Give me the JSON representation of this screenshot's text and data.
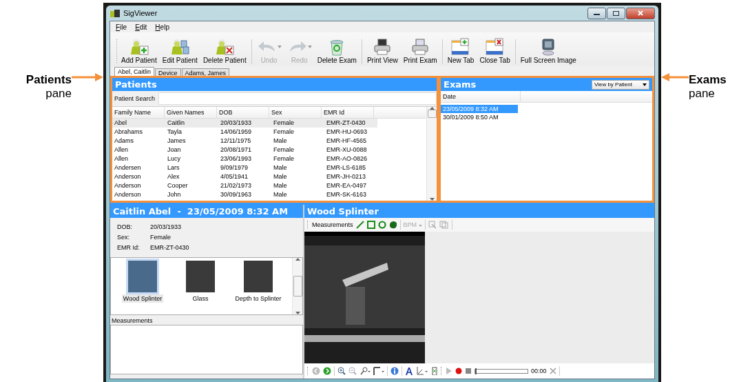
{
  "annotations": [
    {
      "title": "Patients",
      "subtitle": "pane"
    },
    {
      "title": "Exams",
      "subtitle": "pane"
    }
  ],
  "window": {
    "title": "SigViewer"
  },
  "menu": [
    "File",
    "Edit",
    "Help"
  ],
  "toolbar": [
    {
      "kind": "add-patient",
      "label": "Add Patient",
      "disabled": false
    },
    {
      "kind": "edit-patient",
      "label": "Edit Patient",
      "disabled": false
    },
    {
      "kind": "delete-patient",
      "label": "Delete Patient",
      "disabled": false
    },
    {
      "kind": "undo",
      "label": "Undo",
      "disabled": true
    },
    {
      "kind": "redo",
      "label": "Redo",
      "disabled": true
    },
    {
      "kind": "delete-exam",
      "label": "Delete Exam",
      "disabled": false
    },
    {
      "kind": "print-view",
      "label": "Print View",
      "disabled": false
    },
    {
      "kind": "print-exam",
      "label": "Print Exam",
      "disabled": false
    },
    {
      "kind": "new-tab",
      "label": "New Tab",
      "disabled": false
    },
    {
      "kind": "close-tab",
      "label": "Close Tab",
      "disabled": false
    },
    {
      "kind": "full-screen",
      "label": "Full Screen Image",
      "disabled": false
    }
  ],
  "tabs": [
    {
      "label": "Abel, Caitlin",
      "selected": true
    },
    {
      "label": "Device",
      "selected": false
    },
    {
      "label": "Adams, James",
      "selected": false
    }
  ],
  "patients": {
    "title": "Patients",
    "search_label": "Patient Search",
    "columns": [
      "Family Name",
      "Given Names",
      "DOB",
      "Sex",
      "EMR Id"
    ],
    "rows": [
      {
        "cells": [
          "Abel",
          "Caitlin",
          "20/03/1933",
          "Female",
          "EMR-ZT-0430"
        ],
        "selected": true
      },
      {
        "cells": [
          "Abrahams",
          "Tayla",
          "14/06/1959",
          "Female",
          "EMR-HU-0693"
        ],
        "selected": false
      },
      {
        "cells": [
          "Adams",
          "James",
          "12/11/1975",
          "Male",
          "EMR-HF-4565"
        ],
        "selected": false
      },
      {
        "cells": [
          "Allen",
          "Joan",
          "20/08/1971",
          "Female",
          "EMR-XU-0088"
        ],
        "selected": false
      },
      {
        "cells": [
          "Allen",
          "Lucy",
          "23/06/1993",
          "Female",
          "EMR-AO-0826"
        ],
        "selected": false
      },
      {
        "cells": [
          "Andersen",
          "Lars",
          "9/09/1979",
          "Male",
          "EMR-LS-6185"
        ],
        "selected": false
      },
      {
        "cells": [
          "Anderson",
          "Alex",
          "4/05/1941",
          "Male",
          "EMR-JH-0213"
        ],
        "selected": false
      },
      {
        "cells": [
          "Anderson",
          "Cooper",
          "21/02/1973",
          "Male",
          "EMR-EA-0497"
        ],
        "selected": false
      },
      {
        "cells": [
          "Anderson",
          "John",
          "30/09/1963",
          "Male",
          "EMR-SK-6163"
        ],
        "selected": false
      }
    ]
  },
  "exams": {
    "title": "Exams",
    "view_select": "View by Patient",
    "columns": [
      "Date"
    ],
    "rows": [
      {
        "date": "23/05/2009 8:32 AM",
        "selected": true
      },
      {
        "date": "30/01/2009 8:50 AM",
        "selected": false
      }
    ]
  },
  "detail": {
    "name": "Caitlin Abel",
    "date": "23/05/2009 8:32 AM",
    "separator": "-",
    "fields": [
      {
        "label": "DOB:",
        "value": "20/03/1933"
      },
      {
        "label": "Sex:",
        "value": "Female"
      },
      {
        "label": "EMR Id:",
        "value": "EMR-ZT-0430"
      }
    ],
    "images": [
      {
        "label": "Wood Splinter",
        "selected": true
      },
      {
        "label": "Glass",
        "selected": false
      },
      {
        "label": "Depth to Splinter",
        "selected": false
      }
    ],
    "measurements_label": "Measurements"
  },
  "viewer": {
    "title": "Wood Splinter",
    "measure_label": "Measurements",
    "bpm_label": "BPM",
    "playback": {
      "level": 0,
      "time": "00:00"
    }
  }
}
